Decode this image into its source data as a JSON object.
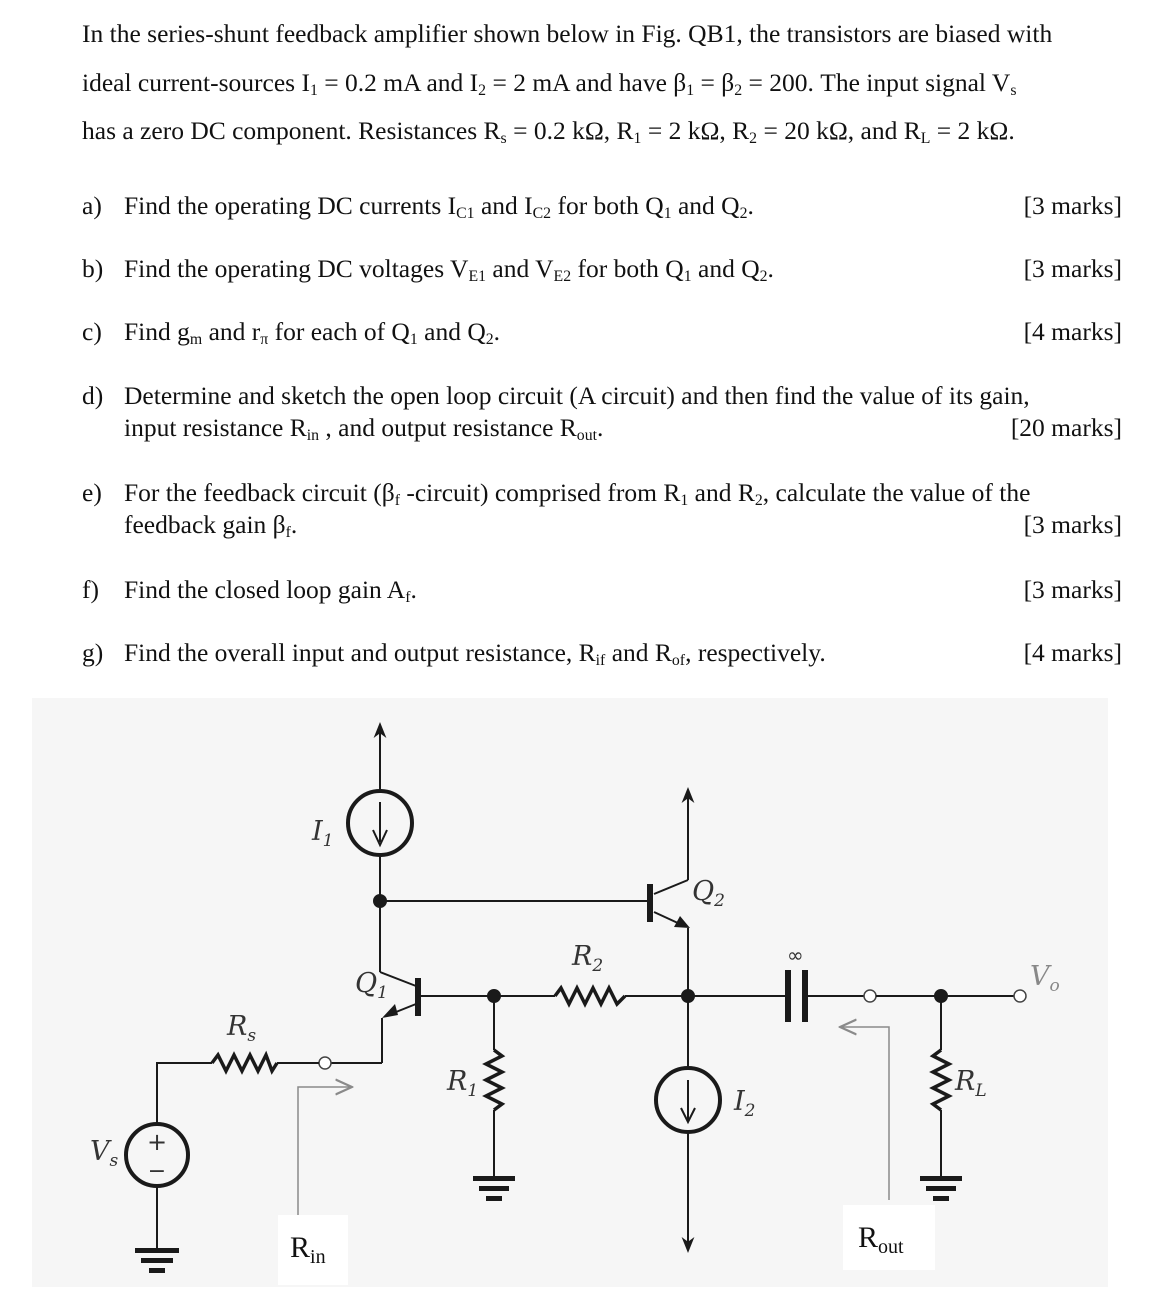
{
  "intro": {
    "line1": "In the series-shunt feedback amplifier shown below in Fig. QB1, the transistors are biased with",
    "line2_parts": [
      "ideal current-sources I",
      "1",
      " = 0.2 mA and I",
      "2",
      " = 2 mA and have β",
      "1",
      " = β",
      "2",
      " = 200. The input signal V",
      "s"
    ],
    "line3_parts": [
      "has a zero DC component. Resistances R",
      "s",
      " = 0.2 kΩ, R",
      "1",
      " = 2 kΩ, R",
      "2",
      " = 20 kΩ, and R",
      "L",
      " = 2 kΩ."
    ]
  },
  "questions": [
    {
      "label": "a)",
      "parts": [
        "Find the operating DC currents I",
        "C1",
        " and I",
        "C2",
        " for both Q",
        "1",
        " and Q",
        "2",
        "."
      ],
      "marks": "[3 marks]"
    },
    {
      "label": "b)",
      "parts": [
        "Find the operating DC voltages V",
        "E1",
        " and V",
        "E2",
        " for both Q",
        "1",
        " and Q",
        "2",
        "."
      ],
      "marks": "[3 marks]"
    },
    {
      "label": "c)",
      "parts": [
        "Find g",
        "m",
        " and r",
        "π",
        " for each of Q",
        "1",
        " and Q",
        "2",
        "."
      ],
      "marks": "[4 marks]"
    },
    {
      "label": "d)",
      "line1": "Determine and sketch the open loop circuit (A circuit) and then find the value of its gain,",
      "parts": [
        "input resistance R",
        "in",
        " , and output resistance R",
        "out",
        "."
      ],
      "marks": "[20 marks]"
    },
    {
      "label": "e)",
      "line1_parts": [
        "For the feedback circuit (β",
        "f",
        " -circuit) comprised from R",
        "1",
        " and R",
        "2",
        ", calculate the value of the"
      ],
      "parts": [
        "feedback gain β",
        "f",
        "."
      ],
      "marks": "[3 marks]"
    },
    {
      "label": "f)",
      "parts": [
        "Find the closed loop gain A",
        "f",
        "."
      ],
      "marks": "[3 marks]"
    },
    {
      "label": "g)",
      "parts": [
        "Find the overall input and output resistance, R",
        "if",
        " and R",
        "of",
        ", respectively."
      ],
      "marks": "[4 marks]"
    }
  ],
  "diagram": {
    "labels": {
      "I1": [
        "I",
        "1"
      ],
      "I2": [
        "I",
        "2"
      ],
      "Q1": [
        "Q",
        "1"
      ],
      "Q2": [
        "Q",
        "2"
      ],
      "R1": [
        "R",
        "1"
      ],
      "R2": [
        "R",
        "2"
      ],
      "Rs": [
        "R",
        "s"
      ],
      "RL": [
        "R",
        "L"
      ],
      "Vs": [
        "V",
        "s"
      ],
      "Vo": [
        "V",
        "o"
      ],
      "cap": "∞",
      "plus": "+",
      "minus": "−",
      "Rin": [
        "R",
        "in"
      ],
      "Rout": [
        "R",
        "out"
      ]
    },
    "colors": {
      "wire": "#1a1a1a",
      "bracket": "#8a8a8a",
      "background": "#f6f6f6"
    }
  }
}
